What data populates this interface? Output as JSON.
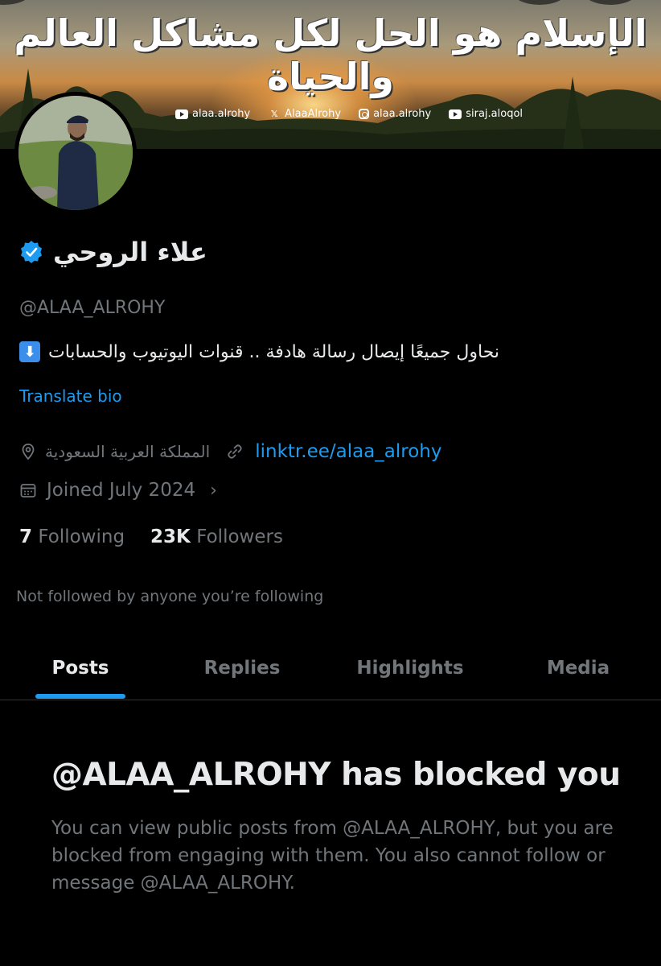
{
  "banner": {
    "title": "الإسلام هو الحل لكل مشاكل العالم والحياة",
    "handles": [
      {
        "icon": "youtube-icon",
        "text": "alaa.alrohy"
      },
      {
        "icon": "x-icon",
        "text": "AlaaAlrohy"
      },
      {
        "icon": "instagram-icon",
        "text": "alaa.alrohy"
      },
      {
        "icon": "youtube-icon",
        "text": "siraj.aloqol"
      }
    ]
  },
  "profile": {
    "display_name": "علاء الروحي",
    "handle": "@ALAA_ALROHY",
    "bio": "نحاول جميعًا إيصال رسالة هادفة .. قنوات اليوتيوب والحسابات",
    "bio_emoji": "⬇",
    "translate_label": "Translate bio",
    "location": "المملكة العربية السعودية",
    "website": "linktr.ee/alaa_alrohy",
    "joined": "Joined July 2024",
    "following_count": "7",
    "following_label": "Following",
    "followers_count": "23K",
    "followers_label": "Followers",
    "not_followed_text": "Not followed by anyone you’re following"
  },
  "tabs": [
    {
      "label": "Posts",
      "active": true
    },
    {
      "label": "Replies",
      "active": false
    },
    {
      "label": "Highlights",
      "active": false
    },
    {
      "label": "Media",
      "active": false
    }
  ],
  "blocked": {
    "title": "@ALAA_ALROHY has blocked you",
    "description": "You can view public posts from @ALAA_ALROHY, but you are blocked from engaging with them. You also cannot follow or message @ALAA_ALROHY."
  },
  "colors": {
    "accent": "#1d9bf0",
    "background": "#000000",
    "text_primary": "#e7e9ea",
    "text_secondary": "#71767b"
  }
}
